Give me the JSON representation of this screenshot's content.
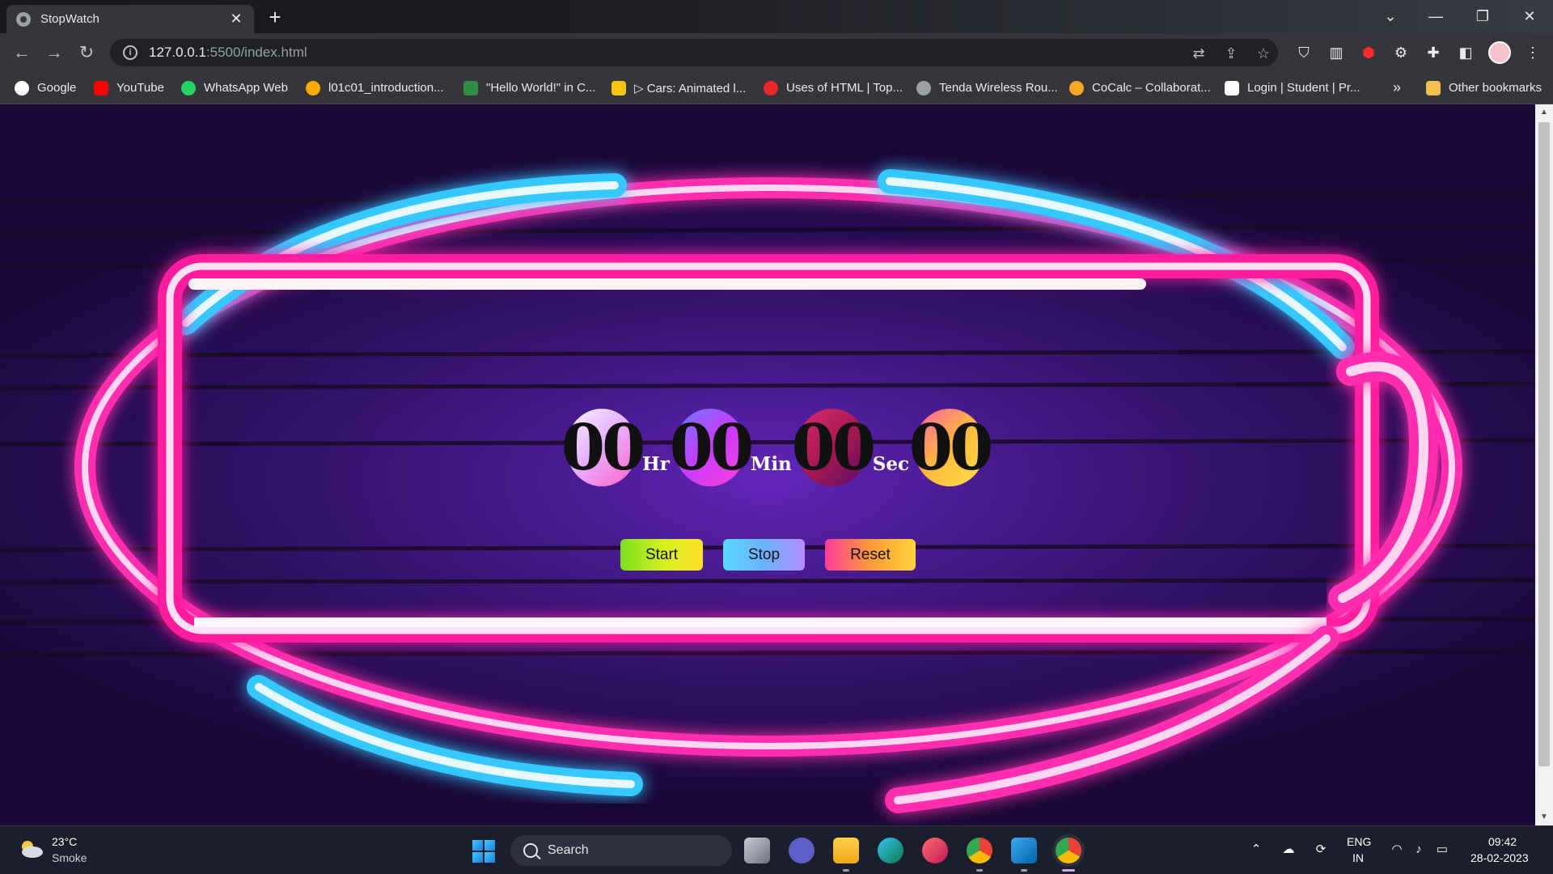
{
  "browser": {
    "tab_title": "StopWatch",
    "tab_close": "✕",
    "new_tab": "+",
    "url_host": "127.0.0.1",
    "url_path": ":5500/index.html",
    "back": "←",
    "forward": "→",
    "reload": "↻",
    "bookmarks_overflow": "»",
    "other_bookmarks": "Other bookmarks",
    "bookmarks": [
      {
        "label": "Google",
        "color": "#ffffff"
      },
      {
        "label": "YouTube",
        "color": "#ff0000"
      },
      {
        "label": "WhatsApp Web",
        "color": "#25d366"
      },
      {
        "label": "l01c01_introduction...",
        "color": "#f9ab00"
      },
      {
        "label": "\"Hello World!\" in C...",
        "color": "#2f8d46"
      },
      {
        "label": "▷ Cars: Animated l...",
        "color": "#f9c513"
      },
      {
        "label": "Uses of HTML | Top...",
        "color": "#e8272a"
      },
      {
        "label": "Tenda Wireless Rou...",
        "color": "#9aa0a6"
      },
      {
        "label": "CoCalc – Collaborat...",
        "color": "#f9a825"
      },
      {
        "label": "Login | Student | Pr...",
        "color": "#ffffff"
      }
    ]
  },
  "stopwatch": {
    "hours": "00",
    "hours_unit": "Hr",
    "minutes": "00",
    "minutes_unit": "Min",
    "seconds": "00",
    "seconds_unit": "Sec",
    "centiseconds": "00",
    "start_label": "Start",
    "stop_label": "Stop",
    "reset_label": "Reset"
  },
  "taskbar": {
    "temperature": "23°C",
    "weather": "Smoke",
    "search_label": "Search",
    "lang_top": "ENG",
    "lang_bottom": "IN",
    "time": "09:42",
    "date": "28-02-2023"
  }
}
